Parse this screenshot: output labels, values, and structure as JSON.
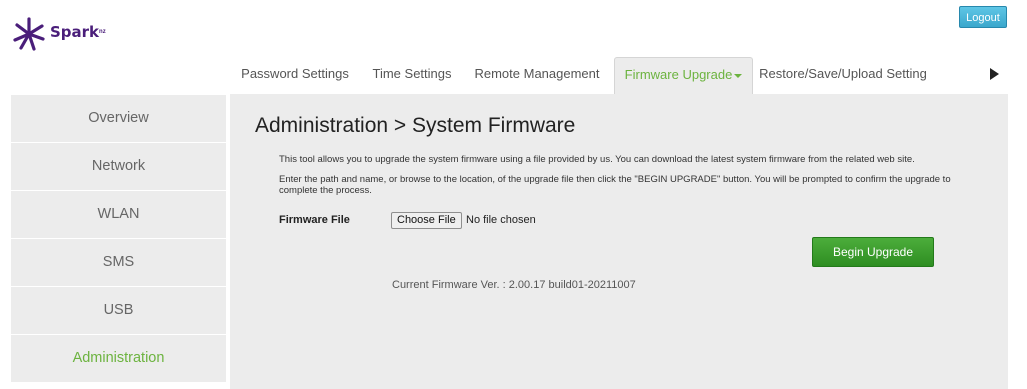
{
  "brand": {
    "name": "Spark",
    "suffix": "nz",
    "logo_icon": "spark-star-icon",
    "color": "#4a1e7a"
  },
  "header": {
    "logout_label": "Logout"
  },
  "tabs": [
    {
      "label": "Password Settings"
    },
    {
      "label": "Time Settings"
    },
    {
      "label": "Remote Management"
    },
    {
      "label": "Firmware Upgrade",
      "active": true
    },
    {
      "label": "Restore/Save/Upload Setting"
    }
  ],
  "tabs_more_icon": "triangle-right-icon",
  "sidebar": {
    "items": [
      {
        "label": "Overview"
      },
      {
        "label": "Network"
      },
      {
        "label": "WLAN"
      },
      {
        "label": "SMS"
      },
      {
        "label": "USB"
      },
      {
        "label": "Administration",
        "active": true
      }
    ]
  },
  "main": {
    "title": "Administration > System Firmware",
    "desc1": "This tool allows you to upgrade the system firmware using a file provided by us. You can download the latest system firmware from the related web site.",
    "desc2": "Enter the path and name, or browse to the location, of the upgrade file then click the \"BEGIN UPGRADE\" button. You will be prompted to confirm the upgrade to complete the process.",
    "firmware_label": "Firmware File",
    "choose_file_label": "Choose File",
    "file_status": "No file chosen",
    "begin_upgrade_label": "Begin Upgrade",
    "current_version": "Current Firmware Ver. : 2.00.17 build01-20211007"
  },
  "colors": {
    "accent_green": "#6cb33f",
    "button_green": "#2e8e22",
    "logout_blue": "#3aa7cc",
    "panel_bg": "#ececec"
  }
}
